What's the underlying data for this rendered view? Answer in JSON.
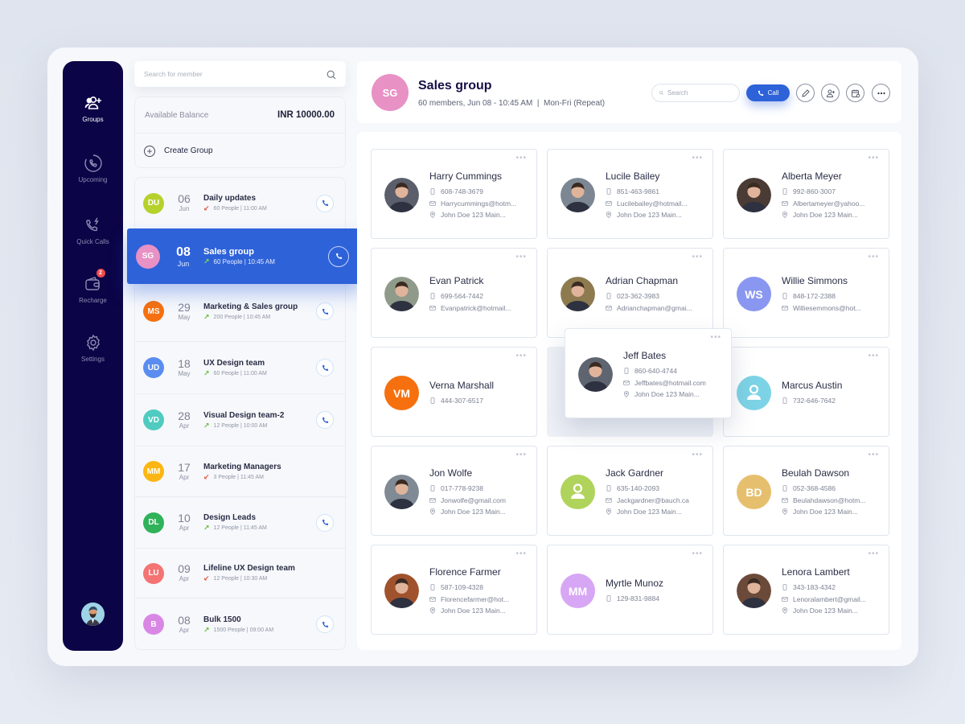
{
  "sidebar": {
    "items": [
      {
        "label": "Groups",
        "icon": "groups-icon",
        "active": true
      },
      {
        "label": "Upcoming",
        "icon": "upcoming-clock-phone-icon",
        "active": false
      },
      {
        "label": "Quick Calls",
        "icon": "quick-call-icon",
        "active": false
      },
      {
        "label": "Recharge",
        "icon": "wallet-icon",
        "active": false,
        "badge": "2"
      },
      {
        "label": "Settings",
        "icon": "gear-icon",
        "active": false
      }
    ],
    "user_avatar": "user-avatar"
  },
  "member_search": {
    "placeholder": "Search for member"
  },
  "balance": {
    "label": "Available Balance",
    "value": "INR 10000.00"
  },
  "create_group": {
    "label": "Create Group"
  },
  "groups": [
    {
      "initials": "DU",
      "color": "#b7d12c",
      "day": "06",
      "month": "Jun",
      "name": "Daily updates",
      "direction": "down",
      "meta": "60 People | 11:00 AM",
      "has_call": true
    },
    {
      "initials": "SG",
      "color": "#e891c4",
      "day": "08",
      "month": "Jun",
      "name": "Sales group",
      "direction": "up",
      "meta": "60 People | 10:45 AM",
      "has_call": true,
      "selected": true
    },
    {
      "initials": "MS",
      "color": "#f6700f",
      "day": "29",
      "month": "May",
      "name": "Marketing & Sales group",
      "direction": "up",
      "meta": "200 People | 10:45 AM",
      "has_call": true
    },
    {
      "initials": "UD",
      "color": "#5b8df0",
      "day": "18",
      "month": "May",
      "name": "UX Design team",
      "direction": "up",
      "meta": "60 People | 11:00 AM",
      "has_call": true
    },
    {
      "initials": "VD",
      "color": "#4fcbc0",
      "day": "28",
      "month": "Apr",
      "name": "Visual Design team-2",
      "direction": "up",
      "meta": "12 People | 10:00 AM",
      "has_call": true
    },
    {
      "initials": "MM",
      "color": "#fbb614",
      "day": "17",
      "month": "Apr",
      "name": "Marketing Managers",
      "direction": "down",
      "meta": "3 People | 11:45 AM",
      "has_call": false
    },
    {
      "initials": "DL",
      "color": "#2fb25a",
      "day": "10",
      "month": "Apr",
      "name": "Design Leads",
      "direction": "up",
      "meta": "12 People | 11:45 AM",
      "has_call": true
    },
    {
      "initials": "LU",
      "color": "#f47373",
      "day": "09",
      "month": "Apr",
      "name": "Lifeline UX Design team",
      "direction": "down",
      "meta": "12 People | 10:30 AM",
      "has_call": false
    },
    {
      "initials": "B",
      "color": "#d987e4",
      "day": "08",
      "month": "Apr",
      "name": "Bulk 1500",
      "direction": "up",
      "meta": "1500 People | 09:00 AM",
      "has_call": true
    }
  ],
  "header": {
    "initials": "SG",
    "title": "Sales group",
    "subtitle": "60 members, Jun 08 - 10:45 AM  |  Mon-Fri (Repeat)",
    "search_placeholder": "Search",
    "call_label": "Call",
    "actions": [
      "edit-icon",
      "add-user-icon",
      "calendar-icon",
      "more-icon"
    ]
  },
  "contacts": [
    {
      "name": "Harry Cummings",
      "phone": "608-748-3679",
      "email": "Harrycummings@hotm...",
      "address": "John Doe 123 Main...",
      "photo": true,
      "photo_bg": "#5a5f6b"
    },
    {
      "name": "Lucile Bailey",
      "phone": "851-463-9861",
      "email": "Lucilebailey@hotmail...",
      "address": "John Doe 123 Main...",
      "photo": true,
      "photo_bg": "#7c8793"
    },
    {
      "name": "Alberta Meyer",
      "phone": "992-860-3007",
      "email": "Albertameyer@yahoo...",
      "address": "John Doe 123 Main...",
      "photo": true,
      "photo_bg": "#4a3b35"
    },
    {
      "name": "Evan Patrick",
      "phone": "699-564-7442",
      "email": "Evanpatrick@hotmail...",
      "photo": true,
      "photo_bg": "#8f9a8a"
    },
    {
      "name": "Adrian Chapman",
      "phone": "023-362-3983",
      "email": "Adrianchapman@gmai...",
      "photo": true,
      "photo_bg": "#8d7a4f"
    },
    {
      "name": "Willie Simmons",
      "initials": "WS",
      "color": "#8a97f0",
      "phone": "848-172-2388",
      "email": "Williesemmons@hot..."
    },
    {
      "name": "Verna Marshall",
      "initials": "VM",
      "color": "#f6700f",
      "phone": "444-307-6517"
    },
    {
      "name": "Jeff Bates",
      "phone": "860-640-4744",
      "email": "Jeffbates@hotmail.com",
      "address": "John Doe 123 Main...",
      "photo": true,
      "photo_bg": "#5e6570",
      "floating": true
    },
    {
      "name": "Marcus Austin",
      "placeholder_icon": true,
      "color": "#7dd3e6",
      "phone": "732-646-7642"
    },
    {
      "name": "Jon Wolfe",
      "phone": "017-778-9238",
      "email": "Jonwolfe@gmail.com",
      "address": "John Doe 123 Main...",
      "photo": true,
      "photo_bg": "#7f8a94"
    },
    {
      "name": "Jack Gardner",
      "placeholder_icon": true,
      "color": "#b0d35b",
      "phone": "635-140-2093",
      "email": "Jackgardner@bauch.ca",
      "address": "John Doe 123 Main..."
    },
    {
      "name": "Beulah Dawson",
      "initials": "BD",
      "color": "#e6bf6e",
      "phone": "052-368-4586",
      "email": "Beulahdawson@hotm...",
      "address": "John Doe 123 Main..."
    },
    {
      "name": "Florence Farmer",
      "phone": "587-109-4328",
      "email": "Florencefarmer@hot...",
      "address": "John Doe 123 Main...",
      "photo": true,
      "photo_bg": "#a0522d"
    },
    {
      "name": "Myrtle Munoz",
      "initials": "MM",
      "color": "#d7a6f5",
      "phone": "129-831-9884"
    },
    {
      "name": "Lenora Lambert",
      "phone": "343-183-4342",
      "email": "Lenoralambert@gmail...",
      "address": "John Doe 123 Main...",
      "photo": true,
      "photo_bg": "#6b4a3a"
    }
  ],
  "colors": {
    "sidebar_bg": "#0b0447",
    "accent": "#2e62d9",
    "badge": "#ef4b4b"
  }
}
